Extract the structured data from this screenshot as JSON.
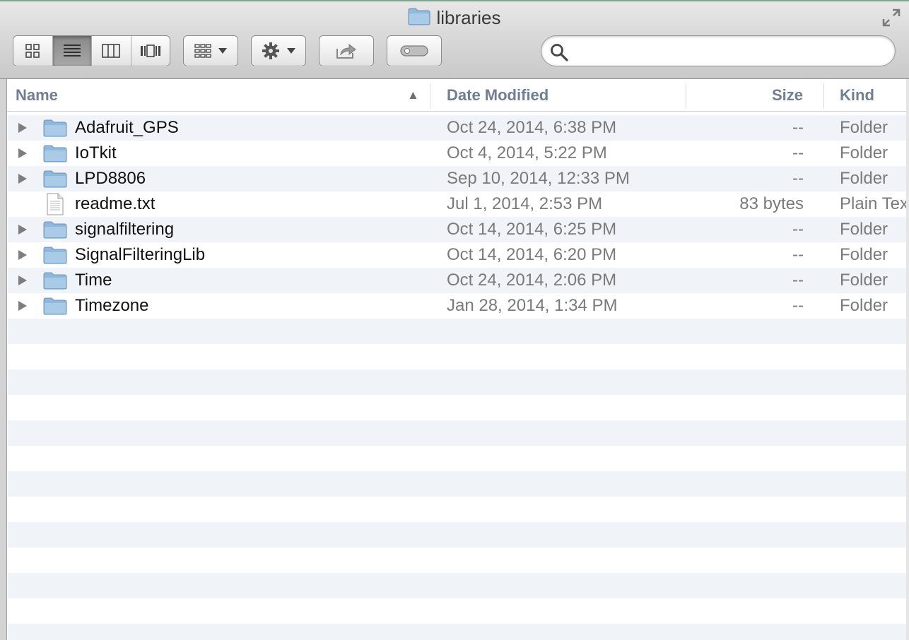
{
  "window": {
    "title": "libraries"
  },
  "toolbar": {
    "view_buttons": [
      "icon-view",
      "list-view",
      "column-view",
      "cover-flow-view"
    ],
    "active_view": "list-view",
    "arrange_icon": "grid-arrange-icon",
    "action_icon": "gear-icon",
    "share_icon": "share-icon",
    "tags_icon": "tag-toggle-icon"
  },
  "search": {
    "value": "",
    "placeholder": ""
  },
  "columns": {
    "name": "Name",
    "date": "Date Modified",
    "size": "Size",
    "kind": "Kind",
    "sort_indicator": "▲"
  },
  "files": [
    {
      "name": "Adafruit_GPS",
      "date": "Oct 24, 2014, 6:38 PM",
      "size": "--",
      "kind": "Folder",
      "type": "folder"
    },
    {
      "name": "IoTkit",
      "date": "Oct 4, 2014, 5:22 PM",
      "size": "--",
      "kind": "Folder",
      "type": "folder"
    },
    {
      "name": "LPD8806",
      "date": "Sep 10, 2014, 12:33 PM",
      "size": "--",
      "kind": "Folder",
      "type": "folder"
    },
    {
      "name": "readme.txt",
      "date": "Jul 1, 2014, 2:53 PM",
      "size": "83 bytes",
      "kind": "Plain Text",
      "type": "file"
    },
    {
      "name": "signalfiltering",
      "date": "Oct 14, 2014, 6:25 PM",
      "size": "--",
      "kind": "Folder",
      "type": "folder"
    },
    {
      "name": "SignalFilteringLib",
      "date": "Oct 14, 2014, 6:20 PM",
      "size": "--",
      "kind": "Folder",
      "type": "folder"
    },
    {
      "name": "Time",
      "date": "Oct 24, 2014, 2:06 PM",
      "size": "--",
      "kind": "Folder",
      "type": "folder"
    },
    {
      "name": "Timezone",
      "date": "Jan 28, 2014, 1:34 PM",
      "size": "--",
      "kind": "Folder",
      "type": "folder"
    }
  ],
  "colors": {
    "header_text": "#6f7f93",
    "row_stripe": "#f0f4f9",
    "folder_blue": "#8fb8db"
  }
}
